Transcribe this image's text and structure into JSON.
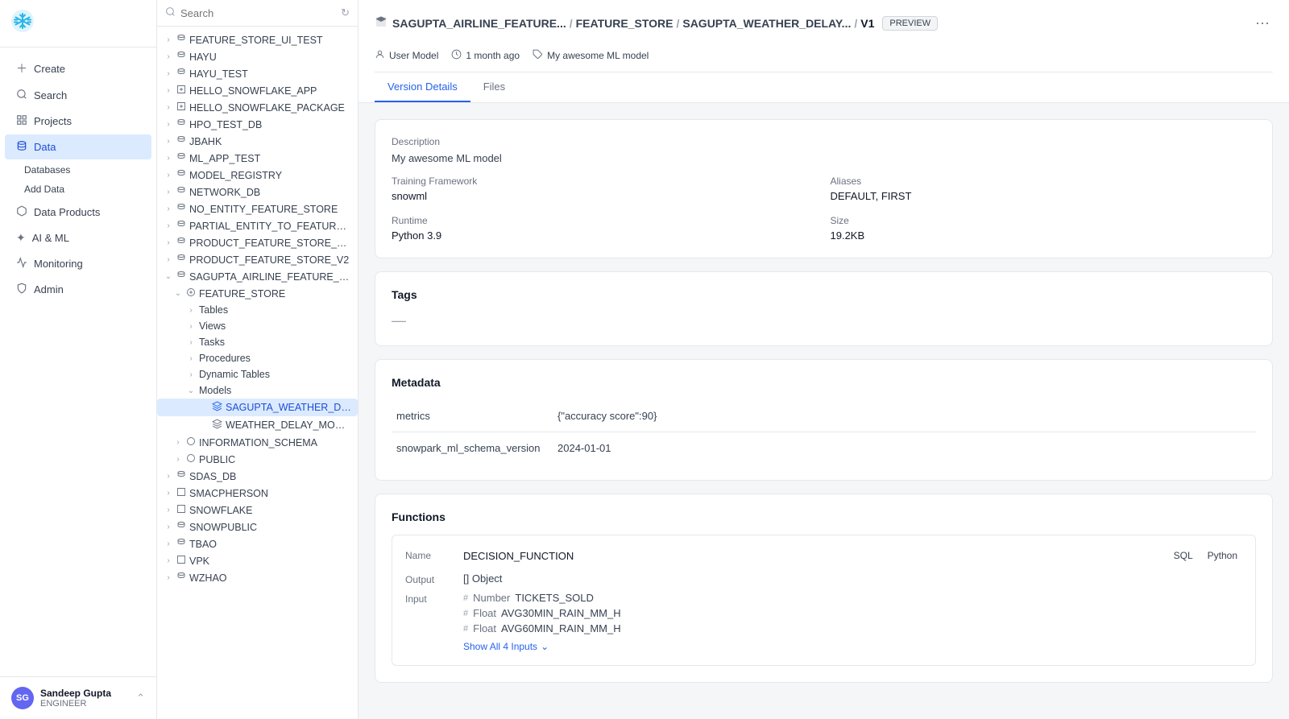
{
  "app": {
    "title": "Snowflake"
  },
  "sidebar": {
    "search_label": "Search",
    "nav_items": [
      {
        "id": "create",
        "label": "Create",
        "icon": "+"
      },
      {
        "id": "search",
        "label": "Search",
        "icon": "🔍"
      },
      {
        "id": "projects",
        "label": "Projects",
        "icon": "📁"
      },
      {
        "id": "data",
        "label": "Data",
        "icon": "🗄️",
        "active": true
      },
      {
        "id": "data-products",
        "label": "Data Products",
        "icon": "📦"
      },
      {
        "id": "ai-ml",
        "label": "AI & ML",
        "icon": "✨"
      },
      {
        "id": "monitoring",
        "label": "Monitoring",
        "icon": "📊"
      },
      {
        "id": "admin",
        "label": "Admin",
        "icon": "⚙️"
      }
    ],
    "sub_items": [
      {
        "id": "databases",
        "label": "Databases",
        "active": true
      },
      {
        "id": "add-data",
        "label": "Add Data"
      }
    ],
    "user": {
      "name": "Sandeep Gupta",
      "role": "ENGINEER",
      "initials": "SG"
    }
  },
  "file_tree": {
    "search_placeholder": "Search",
    "items": [
      {
        "id": "feature_store_ui",
        "label": "FEATURE_STORE_UI_TEST",
        "level": 0,
        "type": "db",
        "expanded": false
      },
      {
        "id": "hayu",
        "label": "HAYU",
        "level": 0,
        "type": "db",
        "expanded": false
      },
      {
        "id": "hayu_test",
        "label": "HAYU_TEST",
        "level": 0,
        "type": "db",
        "expanded": false
      },
      {
        "id": "hello_snowflake_app",
        "label": "HELLO_SNOWFLAKE_APP",
        "level": 0,
        "type": "app",
        "expanded": false
      },
      {
        "id": "hello_snowflake_pkg",
        "label": "HELLO_SNOWFLAKE_PACKAGE",
        "level": 0,
        "type": "app",
        "expanded": false
      },
      {
        "id": "hpo_test_db",
        "label": "HPO_TEST_DB",
        "level": 0,
        "type": "db",
        "expanded": false
      },
      {
        "id": "jbahk",
        "label": "JBAHK",
        "level": 0,
        "type": "db",
        "expanded": false
      },
      {
        "id": "ml_app_test",
        "label": "ML_APP_TEST",
        "level": 0,
        "type": "db",
        "expanded": false
      },
      {
        "id": "model_registry",
        "label": "MODEL_REGISTRY",
        "level": 0,
        "type": "db",
        "expanded": false
      },
      {
        "id": "network_db",
        "label": "NETWORK_DB",
        "level": 0,
        "type": "db",
        "expanded": false
      },
      {
        "id": "no_entity_feature_store",
        "label": "NO_ENTITY_FEATURE_STORE",
        "level": 0,
        "type": "db",
        "expanded": false
      },
      {
        "id": "partial_entity",
        "label": "PARTIAL_ENTITY_TO_FEATURE_VIEW_LI...",
        "level": 0,
        "type": "db",
        "expanded": false
      },
      {
        "id": "product_feature_store_more",
        "label": "PRODUCT_FEATURE_STORE_MORE_ENT...",
        "level": 0,
        "type": "db",
        "expanded": false
      },
      {
        "id": "product_feature_store_v2",
        "label": "PRODUCT_FEATURE_STORE_V2",
        "level": 0,
        "type": "db",
        "expanded": false
      },
      {
        "id": "sagupta_airline",
        "label": "SAGUPTA_AIRLINE_FEATURE_STORE",
        "level": 0,
        "type": "db",
        "expanded": true
      },
      {
        "id": "feature_store_schema",
        "label": "FEATURE_STORE",
        "level": 1,
        "type": "schema",
        "expanded": true
      },
      {
        "id": "tables",
        "label": "Tables",
        "level": 2,
        "type": "folder",
        "expanded": false
      },
      {
        "id": "views",
        "label": "Views",
        "level": 2,
        "type": "folder",
        "expanded": false
      },
      {
        "id": "tasks",
        "label": "Tasks",
        "level": 2,
        "type": "folder",
        "expanded": false
      },
      {
        "id": "procedures",
        "label": "Procedures",
        "level": 2,
        "type": "folder",
        "expanded": false
      },
      {
        "id": "dynamic_tables",
        "label": "Dynamic Tables",
        "level": 2,
        "type": "folder",
        "expanded": false
      },
      {
        "id": "models",
        "label": "Models",
        "level": 2,
        "type": "folder",
        "expanded": true
      },
      {
        "id": "sagupta_weather_delay",
        "label": "SAGUPTA_WEATHER_DELAY_...",
        "level": 3,
        "type": "model",
        "active": true
      },
      {
        "id": "weather_delay_model",
        "label": "WEATHER_DELAY_MODEL",
        "level": 3,
        "type": "model",
        "active": false
      },
      {
        "id": "information_schema",
        "label": "INFORMATION_SCHEMA",
        "level": 1,
        "type": "schema",
        "expanded": false
      },
      {
        "id": "public",
        "label": "PUBLIC",
        "level": 1,
        "type": "schema",
        "expanded": false
      },
      {
        "id": "sdas_db",
        "label": "SDAS_DB",
        "level": 0,
        "type": "db",
        "expanded": false
      },
      {
        "id": "smacpherson",
        "label": "SMACPHERSON",
        "level": 0,
        "type": "app",
        "expanded": false
      },
      {
        "id": "snowflake",
        "label": "SNOWFLAKE",
        "level": 0,
        "type": "app",
        "expanded": false
      },
      {
        "id": "snowpublic",
        "label": "SNOWPUBLIC",
        "level": 0,
        "type": "db",
        "expanded": false
      },
      {
        "id": "tbao",
        "label": "TBAO",
        "level": 0,
        "type": "db",
        "expanded": false
      },
      {
        "id": "vpk",
        "label": "VPK",
        "level": 0,
        "type": "app",
        "expanded": false
      },
      {
        "id": "wzhao",
        "label": "WZHAO",
        "level": 0,
        "type": "db",
        "expanded": false
      }
    ]
  },
  "main": {
    "breadcrumb": {
      "parts": [
        "SAGUPTA_AIRLINE_FEATURE...",
        "FEATURE_STORE",
        "SAGUPTA_WEATHER_DELAY...",
        "V1"
      ],
      "preview_label": "PREVIEW"
    },
    "meta": {
      "user_model_label": "User Model",
      "time_label": "1 month ago",
      "model_label": "My awesome ML model"
    },
    "tabs": [
      {
        "id": "version-details",
        "label": "Version Details",
        "active": true
      },
      {
        "id": "files",
        "label": "Files",
        "active": false
      }
    ],
    "version_details": {
      "description_label": "Description",
      "description_value": "My awesome ML model",
      "training_framework_label": "Training Framework",
      "training_framework_value": "snowml",
      "aliases_label": "Aliases",
      "aliases_value": "DEFAULT, FIRST",
      "runtime_label": "Runtime",
      "runtime_value": "Python 3.9",
      "size_label": "Size",
      "size_value": "19.2KB",
      "tags_label": "Tags",
      "tags_placeholder": "—",
      "metadata_label": "Metadata",
      "metadata_rows": [
        {
          "key": "metrics",
          "value": "{\"accuracy score\":90}"
        },
        {
          "key": "snowpark_ml_schema_version",
          "value": "2024-01-01"
        }
      ],
      "functions_label": "Functions",
      "function": {
        "name_label": "Name",
        "name_value": "DECISION_FUNCTION",
        "output_label": "Output",
        "output_value": "[] Object",
        "input_label": "Input",
        "inputs": [
          {
            "icon": "#",
            "type": "Number",
            "name": "TICKETS_SOLD"
          },
          {
            "icon": "#",
            "type": "Float",
            "name": "AVG30MIN_RAIN_MM_H"
          },
          {
            "icon": "#",
            "type": "Float",
            "name": "AVG60MIN_RAIN_MM_H"
          }
        ],
        "show_all_label": "Show All 4 Inputs",
        "lang_sql": "SQL",
        "lang_python": "Python"
      }
    }
  }
}
